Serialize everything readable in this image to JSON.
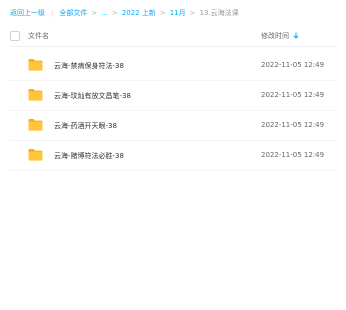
{
  "breadcrumb": {
    "back": "返回上一级",
    "all_files": "全部文件",
    "ellipsis": "...",
    "level_year": "2022 上新",
    "level_month": "11月",
    "current": "13.云海法课",
    "sep_symbol": ">",
    "bar_symbol": "|"
  },
  "table": {
    "col_name": "文件名",
    "col_time": "修改时间",
    "sort_icon": "arrow-down-icon"
  },
  "files": [
    {
      "name": "云海-禁病保身符法-38",
      "time": "2022-11-05 12:49",
      "icon": "folder-icon"
    },
    {
      "name": "云海-玟灿有放文昌笔-38",
      "time": "2022-11-05 12:49",
      "icon": "folder-icon"
    },
    {
      "name": "云海-药酒开天眼-38",
      "time": "2022-11-05 12:49",
      "icon": "folder-icon"
    },
    {
      "name": "云海-赌博符法必胜-38",
      "time": "2022-11-05 12:49",
      "icon": "folder-icon"
    }
  ],
  "colors": {
    "accent": "#06a7ff",
    "folder": "#ffc53d",
    "folder_tab": "#f5b014"
  }
}
